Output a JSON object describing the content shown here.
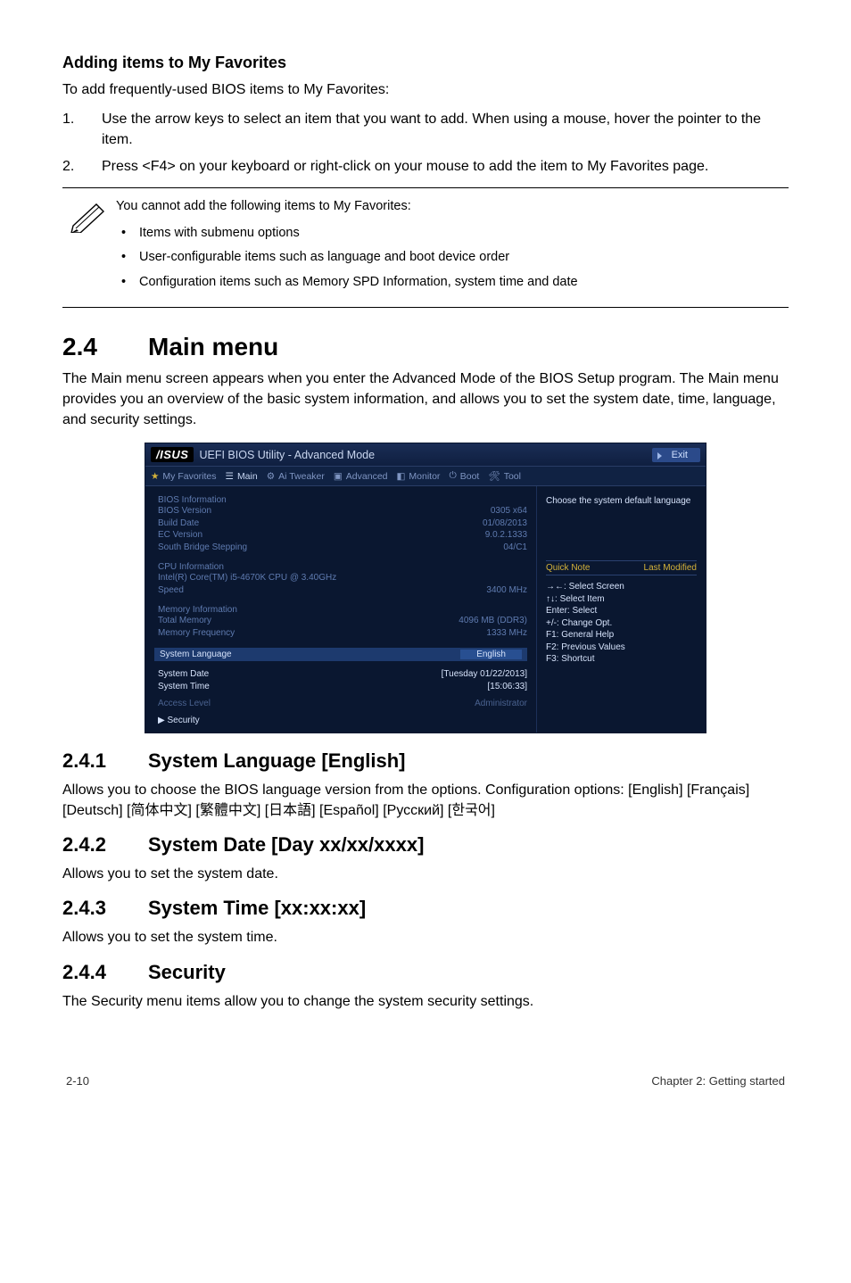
{
  "section_adding": {
    "title": "Adding items to My Favorites",
    "intro": "To add frequently-used BIOS items to My Favorites:",
    "steps": [
      "Use the arrow keys to select an item that you want to add. When using a mouse, hover the pointer to the item.",
      "Press <F4> on your keyboard or right-click on your mouse to add the item to My Favorites page."
    ],
    "note_lead": "You cannot add the following items to My Favorites:",
    "note_items": [
      "Items with submenu options",
      "User-configurable items such as language and boot device order",
      "Configuration items such as Memory SPD Information, system time and date"
    ]
  },
  "section24": {
    "num": "2.4",
    "title": "Main menu",
    "para": "The Main menu screen appears when you enter the Advanced Mode of the BIOS Setup program. The Main menu provides you an overview of the basic system information, and allows you to set the system date, time, language, and security settings."
  },
  "bios": {
    "brand": "/ISUS",
    "title": "UEFI BIOS Utility - Advanced Mode",
    "exit": "Exit",
    "tabs": [
      "My Favorites",
      "Main",
      "Ai Tweaker",
      "Advanced",
      "Monitor",
      "Boot",
      "Tool"
    ],
    "left": {
      "bios_info_head": "BIOS Information",
      "rows1": [
        {
          "k": "BIOS Version",
          "v": "0305 x64"
        },
        {
          "k": "Build Date",
          "v": "01/08/2013"
        },
        {
          "k": "EC Version",
          "v": "9.0.2.1333"
        },
        {
          "k": "South Bridge Stepping",
          "v": "04/C1"
        }
      ],
      "cpu_head": "CPU Information",
      "cpu_name": "Intel(R) Core(TM) i5-4670K CPU @ 3.40GHz",
      "cpu_rows": [
        {
          "k": "Speed",
          "v": "3400 MHz"
        }
      ],
      "mem_head": "Memory Information",
      "mem_rows": [
        {
          "k": "Total Memory",
          "v": "4096 MB (DDR3)"
        },
        {
          "k": "Memory Frequency",
          "v": "1333 MHz"
        }
      ],
      "lang_label": "System Language",
      "lang_value": "English",
      "sysdate_label": "System Date",
      "sysdate_value": "[Tuesday 01/22/2013]",
      "systime_label": "System Time",
      "systime_value": "[15:06:33]",
      "access_label": "Access Level",
      "access_value": "Administrator",
      "security_label": "▶ Security"
    },
    "right": {
      "hint": "Choose the system default language",
      "quick": "Quick Note",
      "last": "Last Modified",
      "keys": [
        {
          "k": "→←:",
          "v": "Select Screen"
        },
        {
          "k": "↑↓:",
          "v": "Select Item"
        },
        {
          "k": "Enter:",
          "v": "Select"
        },
        {
          "k": "+/-:",
          "v": "Change Opt."
        },
        {
          "k": "F1:",
          "v": "General Help"
        },
        {
          "k": "F2:",
          "v": "Previous Values"
        },
        {
          "k": "F3:",
          "v": "Shortcut"
        }
      ]
    }
  },
  "s241": {
    "num": "2.4.1",
    "title": "System Language [English]",
    "p1": "Allows you to choose the BIOS language version from the options. Configuration options: [English] [Français] [Deutsch] [简体中文] [繁體中文] [日本語] [Español] [Русский] [한국어]"
  },
  "s242": {
    "num": "2.4.2",
    "title": "System Date [Day xx/xx/xxxx]",
    "p": "Allows you to set the system date."
  },
  "s243": {
    "num": "2.4.3",
    "title": "System Time [xx:xx:xx]",
    "p": "Allows you to set the system time."
  },
  "s244": {
    "num": "2.4.4",
    "title": "Security",
    "p": "The Security menu items allow you to change the system security settings."
  },
  "footer": {
    "left": "2-10",
    "right": "Chapter 2: Getting started"
  }
}
